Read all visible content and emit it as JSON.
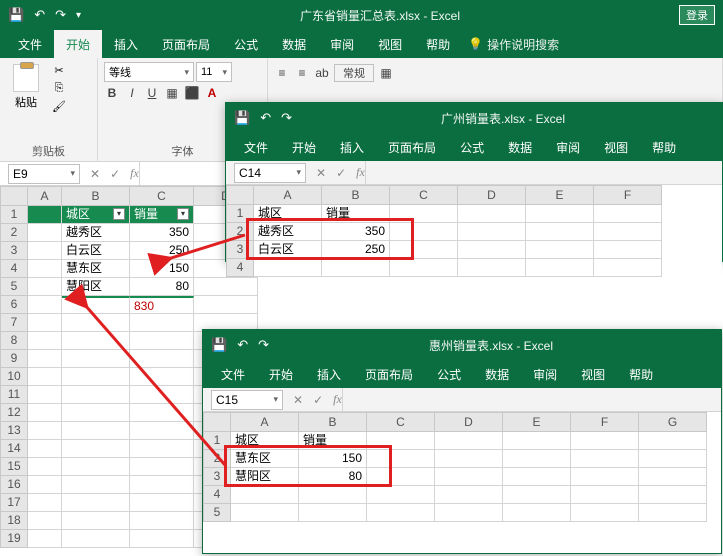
{
  "main": {
    "title": "广东省销量汇总表.xlsx - Excel",
    "login": "登录",
    "tabs": [
      "文件",
      "开始",
      "插入",
      "页面布局",
      "公式",
      "数据",
      "审阅",
      "视图",
      "帮助"
    ],
    "active_tab": "开始",
    "tell_me": "操作说明搜索",
    "group_clipboard": "剪贴板",
    "group_font": "字体",
    "paste": "粘贴",
    "font_name": "等线",
    "font_size": "11",
    "name_box": "E9",
    "colA_w": 34,
    "colB_w": 68,
    "colC_w": 64,
    "colD_w": 64,
    "headers": {
      "b": "城区",
      "c": "销量"
    },
    "rows": [
      {
        "b": "越秀区",
        "c": "350"
      },
      {
        "b": "白云区",
        "c": "250"
      },
      {
        "b": "慧东区",
        "c": "150"
      },
      {
        "b": "慧阳区",
        "c": "80"
      }
    ],
    "sum": "830"
  },
  "sub1": {
    "title": "广州销量表.xlsx - Excel",
    "tabs": [
      "文件",
      "开始",
      "插入",
      "页面布局",
      "公式",
      "数据",
      "审阅",
      "视图",
      "帮助"
    ],
    "name_box": "C14",
    "headers": {
      "a": "城区",
      "b": "销量"
    },
    "rows": [
      {
        "a": "越秀区",
        "b": "350"
      },
      {
        "a": "白云区",
        "b": "250"
      }
    ]
  },
  "sub2": {
    "title": "惠州销量表.xlsx - Excel",
    "tabs": [
      "文件",
      "开始",
      "插入",
      "页面布局",
      "公式",
      "数据",
      "审阅",
      "视图",
      "帮助"
    ],
    "name_box": "C15",
    "headers": {
      "a": "城区",
      "b": "销量"
    },
    "rows": [
      {
        "a": "慧东区",
        "b": "150"
      },
      {
        "a": "慧阳区",
        "b": "80"
      }
    ]
  },
  "chart_data": [
    {
      "type": "table",
      "title": "广东省销量汇总表",
      "columns": [
        "城区",
        "销量"
      ],
      "rows": [
        [
          "越秀区",
          350
        ],
        [
          "白云区",
          250
        ],
        [
          "慧东区",
          150
        ],
        [
          "慧阳区",
          80
        ]
      ],
      "total": 830
    },
    {
      "type": "table",
      "title": "广州销量表",
      "columns": [
        "城区",
        "销量"
      ],
      "rows": [
        [
          "越秀区",
          350
        ],
        [
          "白云区",
          250
        ]
      ]
    },
    {
      "type": "table",
      "title": "惠州销量表",
      "columns": [
        "城区",
        "销量"
      ],
      "rows": [
        [
          "慧东区",
          150
        ],
        [
          "慧阳区",
          80
        ]
      ]
    }
  ]
}
